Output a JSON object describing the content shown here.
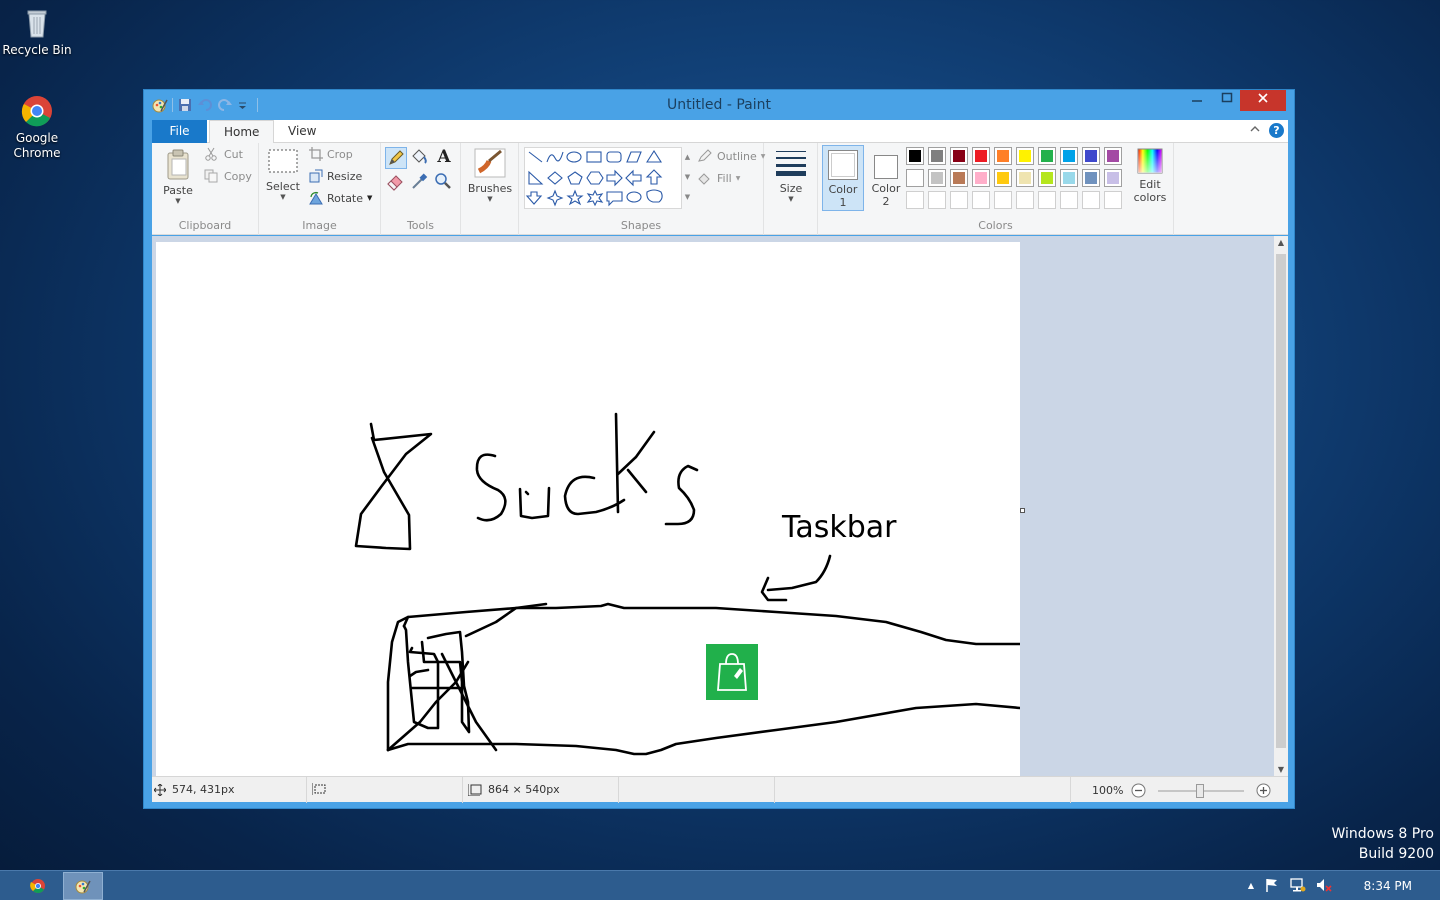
{
  "desktop": {
    "icons": [
      {
        "label": "Recycle Bin",
        "icon": "recycle-bin-icon"
      },
      {
        "label": "Google\nChrome",
        "icon": "chrome-icon"
      }
    ],
    "watermark": {
      "line1": "Windows 8 Pro",
      "line2": "Build 9200"
    }
  },
  "window": {
    "title": "Untitled - Paint",
    "tabs": {
      "file": "File",
      "home": "Home",
      "view": "View"
    }
  },
  "ribbon": {
    "clipboard": {
      "paste": "Paste",
      "cut": "Cut",
      "copy": "Copy",
      "group": "Clipboard"
    },
    "image": {
      "select": "Select",
      "crop": "Crop",
      "resize": "Resize",
      "rotate": "Rotate",
      "group": "Image"
    },
    "tools": {
      "group": "Tools"
    },
    "brushes": {
      "label": "Brushes"
    },
    "shapes": {
      "outline": "Outline",
      "fill": "Fill",
      "group": "Shapes"
    },
    "size": {
      "label": "Size"
    },
    "colors": {
      "color1": "Color",
      "color1_num": "1",
      "color2": "Color",
      "color2_num": "2",
      "edit": "Edit",
      "edit2": "colors",
      "group": "Colors",
      "palette_row1": [
        "#000000",
        "#7f7f7f",
        "#880015",
        "#ed1c24",
        "#ff7f27",
        "#fff200",
        "#22b14c",
        "#00a2e8",
        "#3f48cc",
        "#a349a4"
      ],
      "palette_row2": [
        "#ffffff",
        "#c3c3c3",
        "#b97a57",
        "#ffaec9",
        "#ffc90e",
        "#efe4b0",
        "#b5e61d",
        "#99d9ea",
        "#7092be",
        "#c8bfe7"
      ]
    }
  },
  "canvas": {
    "text_label": "Taskbar"
  },
  "status": {
    "cursor": "574, 431px",
    "canvas_size": "864 × 540px",
    "zoom": "100%"
  },
  "taskbar": {
    "time": "8:34 PM"
  }
}
